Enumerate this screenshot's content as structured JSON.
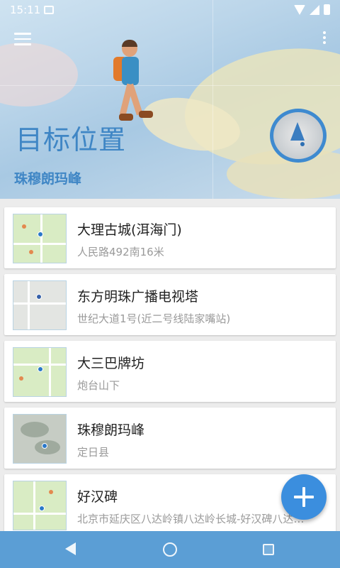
{
  "status_bar": {
    "time": "15:11",
    "icons": [
      "image-icon",
      "wifi-icon",
      "signal-icon",
      "battery-icon"
    ]
  },
  "header": {
    "title": "目标位置",
    "subtitle": "珠穆朗玛峰",
    "menu_icon": "hamburger-menu-icon",
    "overflow_icon": "more-vert-icon",
    "compass_icon": "compass-icon"
  },
  "locations": [
    {
      "name": "大理古城(洱海门)",
      "address": "人民路492南16米",
      "thumb_style": "green"
    },
    {
      "name": "东方明珠广播电视塔",
      "address": "世纪大道1号(近二号线陆家嘴站)",
      "thumb_style": "gray"
    },
    {
      "name": "大三巴牌坊",
      "address": "炮台山下",
      "thumb_style": "green"
    },
    {
      "name": "珠穆朗玛峰",
      "address": "定日县",
      "thumb_style": "satellite"
    },
    {
      "name": "好汉碑",
      "address": "北京市延庆区八达岭镇八达岭长城-好汉碑八达…",
      "thumb_style": "green"
    }
  ],
  "fab": {
    "icon": "plus-icon"
  },
  "nav_bar": {
    "icons": [
      "back-icon",
      "home-icon",
      "recents-icon"
    ]
  },
  "colors": {
    "accent": "#3b8ede",
    "title_blue": "#3f86c5",
    "nav_bar": "#5b9ed5"
  }
}
